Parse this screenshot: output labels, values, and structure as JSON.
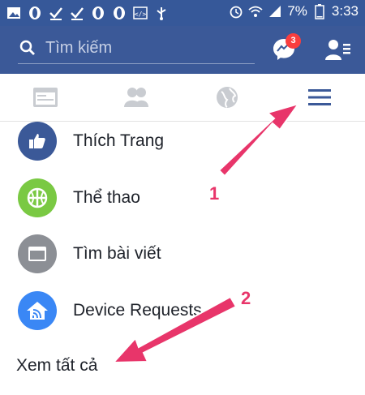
{
  "status_bar": {
    "battery": "7%",
    "time": "3:33",
    "left_icons": [
      "image-icon",
      "opera-icon",
      "check-icon",
      "check-icon",
      "opera-icon",
      "opera-icon",
      "code-icon",
      "usb-icon"
    ],
    "right_icons": [
      "alarm-icon",
      "wifi-icon",
      "signal-icon",
      "battery-icon"
    ]
  },
  "header": {
    "search_placeholder": "Tìm kiếm",
    "messenger_badge": "3",
    "colors": {
      "brand": "#3b5998",
      "status": "#365899",
      "badge": "#fa3e3e"
    }
  },
  "tabs": [
    {
      "name": "news-feed",
      "icon": "news-feed-icon",
      "active": false
    },
    {
      "name": "friends",
      "icon": "friends-icon",
      "active": false
    },
    {
      "name": "notifications",
      "icon": "globe-icon",
      "active": false
    },
    {
      "name": "menu",
      "icon": "hamburger-icon",
      "active": true
    }
  ],
  "menu": {
    "items": [
      {
        "label": "Thích Trang",
        "icon": "thumbs-up-icon",
        "color": "#3b5998"
      },
      {
        "label": "Thể thao",
        "icon": "sports-ball-icon",
        "color": "#7ac943"
      },
      {
        "label": "Tìm bài viết",
        "icon": "browser-window-icon",
        "color": "#8c8f95"
      },
      {
        "label": "Device Requests",
        "icon": "device-home-icon",
        "color": "#3a87f5"
      }
    ],
    "see_all": "Xem tất cả"
  },
  "annotations": {
    "arrow_color": "#e8356a",
    "label_1": "1",
    "label_2": "2"
  }
}
